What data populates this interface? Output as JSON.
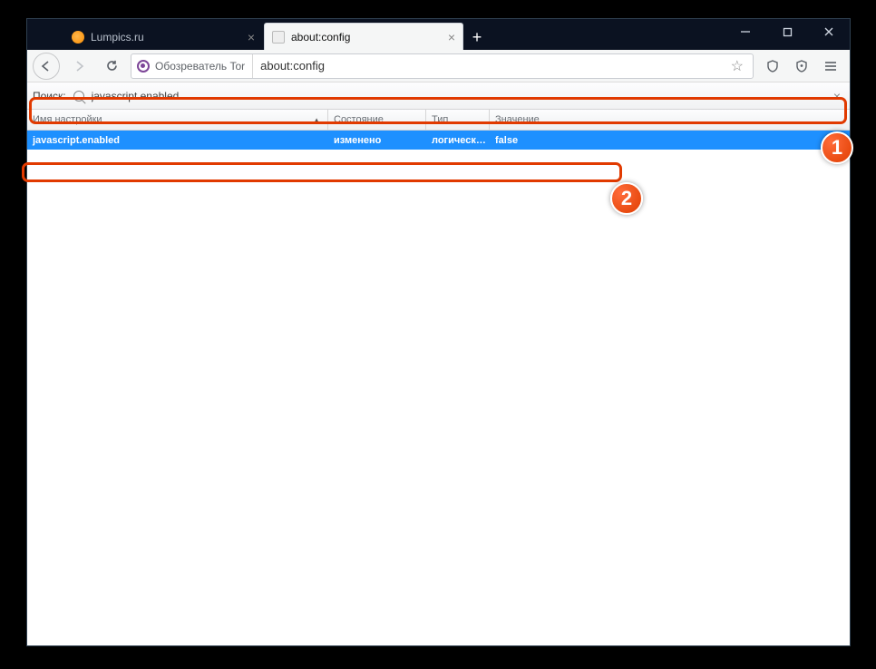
{
  "tabs": [
    {
      "title": "Lumpics.ru",
      "active": false
    },
    {
      "title": "about:config",
      "active": true
    }
  ],
  "window_controls": {
    "minimize": "—",
    "maximize": "▢",
    "close": "✕"
  },
  "toolbar": {
    "identity_label": "Обозреватель Tor",
    "url": "about:config"
  },
  "search": {
    "label": "Поиск:",
    "value": "javascript.enabled"
  },
  "columns": {
    "name": "Имя настройки",
    "state": "Состояние",
    "type": "Тип",
    "value": "Значение"
  },
  "prefs": [
    {
      "name": "javascript.enabled",
      "state": "изменено",
      "type": "логическ…",
      "value": "false"
    }
  ],
  "annotations": {
    "step1": "1",
    "step2": "2"
  }
}
